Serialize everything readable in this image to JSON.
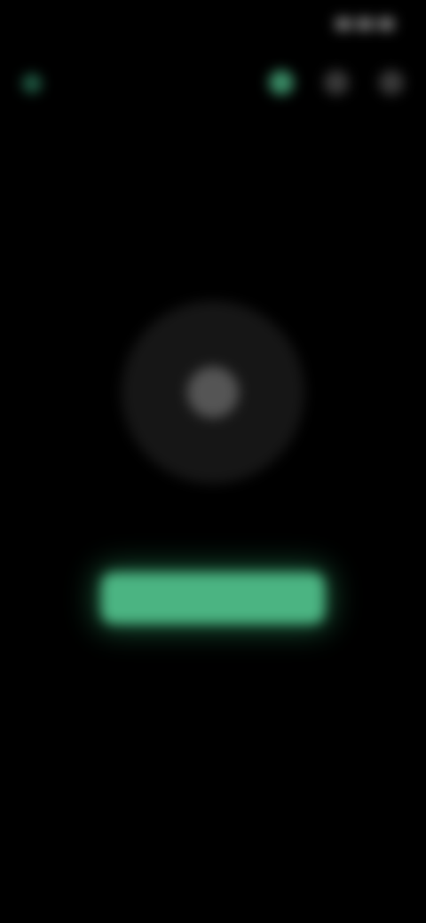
{
  "status_bar": {
    "time": "",
    "icons": [
      "signal-icon",
      "wifi-icon",
      "battery-icon"
    ]
  },
  "header": {
    "back_icon": "back-arrow-icon",
    "actions": [
      {
        "icon": "add-icon",
        "style": "primary"
      },
      {
        "icon": "search-icon",
        "style": "neutral"
      },
      {
        "icon": "more-icon",
        "style": "neutral"
      }
    ]
  },
  "empty_state": {
    "icon": "empty-placeholder-icon",
    "message_line1": "",
    "message_line2": ""
  },
  "cta": {
    "label": ""
  },
  "colors": {
    "background": "#000000",
    "accent": "#4bb482",
    "accent_dark": "#1f5a43"
  }
}
